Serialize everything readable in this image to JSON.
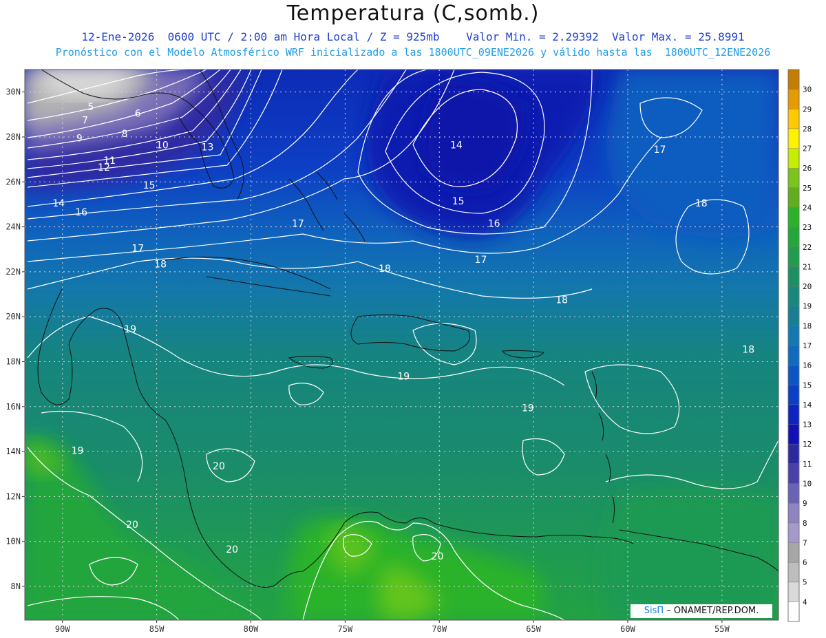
{
  "title": "Temperatura (C,somb.)",
  "subtitle_line1": "12-Ene-2026  0600 UTC / 2:00 am Hora Local / Z = 925mb    Valor Min. = 2.29392  Valor Max. = 25.8991",
  "subtitle_line2": "Pronóstico con el Modelo Atmosférico WRF inicializado a las 1800UTC_09ENE2026 y válido hasta las  1800UTC_12ENE2026",
  "credit": {
    "brand": "SisΠ",
    "text": " – ONAMET/REP.DOM."
  },
  "chart_data": {
    "type": "heatmap",
    "variable": "Temperatura (C,somb.)",
    "level": "925mb",
    "value_min": 2.29392,
    "value_max": 25.8991,
    "lon_range": [
      -92,
      -52
    ],
    "lat_range": [
      6.5,
      31
    ],
    "lon_ticks": [
      "90W",
      "85W",
      "80W",
      "75W",
      "70W",
      "65W",
      "60W",
      "55W"
    ],
    "lat_ticks": [
      "30N",
      "28N",
      "26N",
      "24N",
      "22N",
      "20N",
      "18N",
      "16N",
      "14N",
      "12N",
      "10N",
      "8N"
    ],
    "grid": true,
    "colorbar": {
      "levels": [
        4,
        5,
        6,
        7,
        8,
        9,
        10,
        11,
        12,
        13,
        14,
        15,
        16,
        17,
        18,
        19,
        20,
        21,
        22,
        23,
        24,
        25,
        26,
        27,
        28,
        29,
        30
      ],
      "colors": [
        "#ffffff",
        "#d9d9d9",
        "#bdbdbd",
        "#a6a6a6",
        "#a599c9",
        "#8e83c0",
        "#6a62b5",
        "#4a40a8",
        "#2c28a0",
        "#1010b4",
        "#0c24c0",
        "#0b3fc8",
        "#0c55c4",
        "#0f6bbe",
        "#1379b0",
        "#167f94",
        "#18877e",
        "#1b9064",
        "#1f9c4c",
        "#22a838",
        "#2bb12a",
        "#5fae1e",
        "#7bc41c",
        "#c6ee00",
        "#fff200",
        "#ffca00",
        "#e69b00",
        "#c47d00"
      ],
      "label_position": "right"
    },
    "contour_labels": [
      {
        "lon": -88.5,
        "lat": 29.2,
        "value": "5"
      },
      {
        "lon": -86.0,
        "lat": 28.9,
        "value": "6"
      },
      {
        "lon": -88.8,
        "lat": 28.6,
        "value": "7"
      },
      {
        "lon": -86.7,
        "lat": 28.0,
        "value": "8"
      },
      {
        "lon": -89.1,
        "lat": 27.8,
        "value": "9"
      },
      {
        "lon": -84.7,
        "lat": 27.5,
        "value": "10"
      },
      {
        "lon": -87.5,
        "lat": 26.8,
        "value": "11"
      },
      {
        "lon": -87.8,
        "lat": 26.5,
        "value": "12"
      },
      {
        "lon": -82.3,
        "lat": 27.4,
        "value": "13"
      },
      {
        "lon": -90.2,
        "lat": 24.9,
        "value": "14"
      },
      {
        "lon": -69.1,
        "lat": 27.5,
        "value": "14"
      },
      {
        "lon": -85.4,
        "lat": 25.7,
        "value": "15"
      },
      {
        "lon": -69.0,
        "lat": 25.0,
        "value": "15"
      },
      {
        "lon": -89.0,
        "lat": 24.5,
        "value": "16"
      },
      {
        "lon": -67.1,
        "lat": 24.0,
        "value": "16"
      },
      {
        "lon": -86.0,
        "lat": 22.9,
        "value": "17"
      },
      {
        "lon": -77.5,
        "lat": 24.0,
        "value": "17"
      },
      {
        "lon": -67.8,
        "lat": 22.4,
        "value": "17"
      },
      {
        "lon": -58.3,
        "lat": 27.3,
        "value": "17"
      },
      {
        "lon": -84.8,
        "lat": 22.2,
        "value": "18"
      },
      {
        "lon": -72.9,
        "lat": 22.0,
        "value": "18"
      },
      {
        "lon": -63.5,
        "lat": 20.6,
        "value": "18"
      },
      {
        "lon": -56.1,
        "lat": 24.9,
        "value": "18"
      },
      {
        "lon": -53.6,
        "lat": 18.4,
        "value": "18"
      },
      {
        "lon": -86.4,
        "lat": 19.3,
        "value": "19"
      },
      {
        "lon": -71.9,
        "lat": 17.2,
        "value": "19"
      },
      {
        "lon": -65.3,
        "lat": 15.8,
        "value": "19"
      },
      {
        "lon": -89.2,
        "lat": 13.9,
        "value": "19"
      },
      {
        "lon": -81.7,
        "lat": 13.2,
        "value": "20"
      },
      {
        "lon": -86.3,
        "lat": 10.6,
        "value": "20"
      },
      {
        "lon": -81.0,
        "lat": 9.5,
        "value": "20"
      },
      {
        "lon": -70.1,
        "lat": 9.2,
        "value": "20"
      }
    ]
  }
}
